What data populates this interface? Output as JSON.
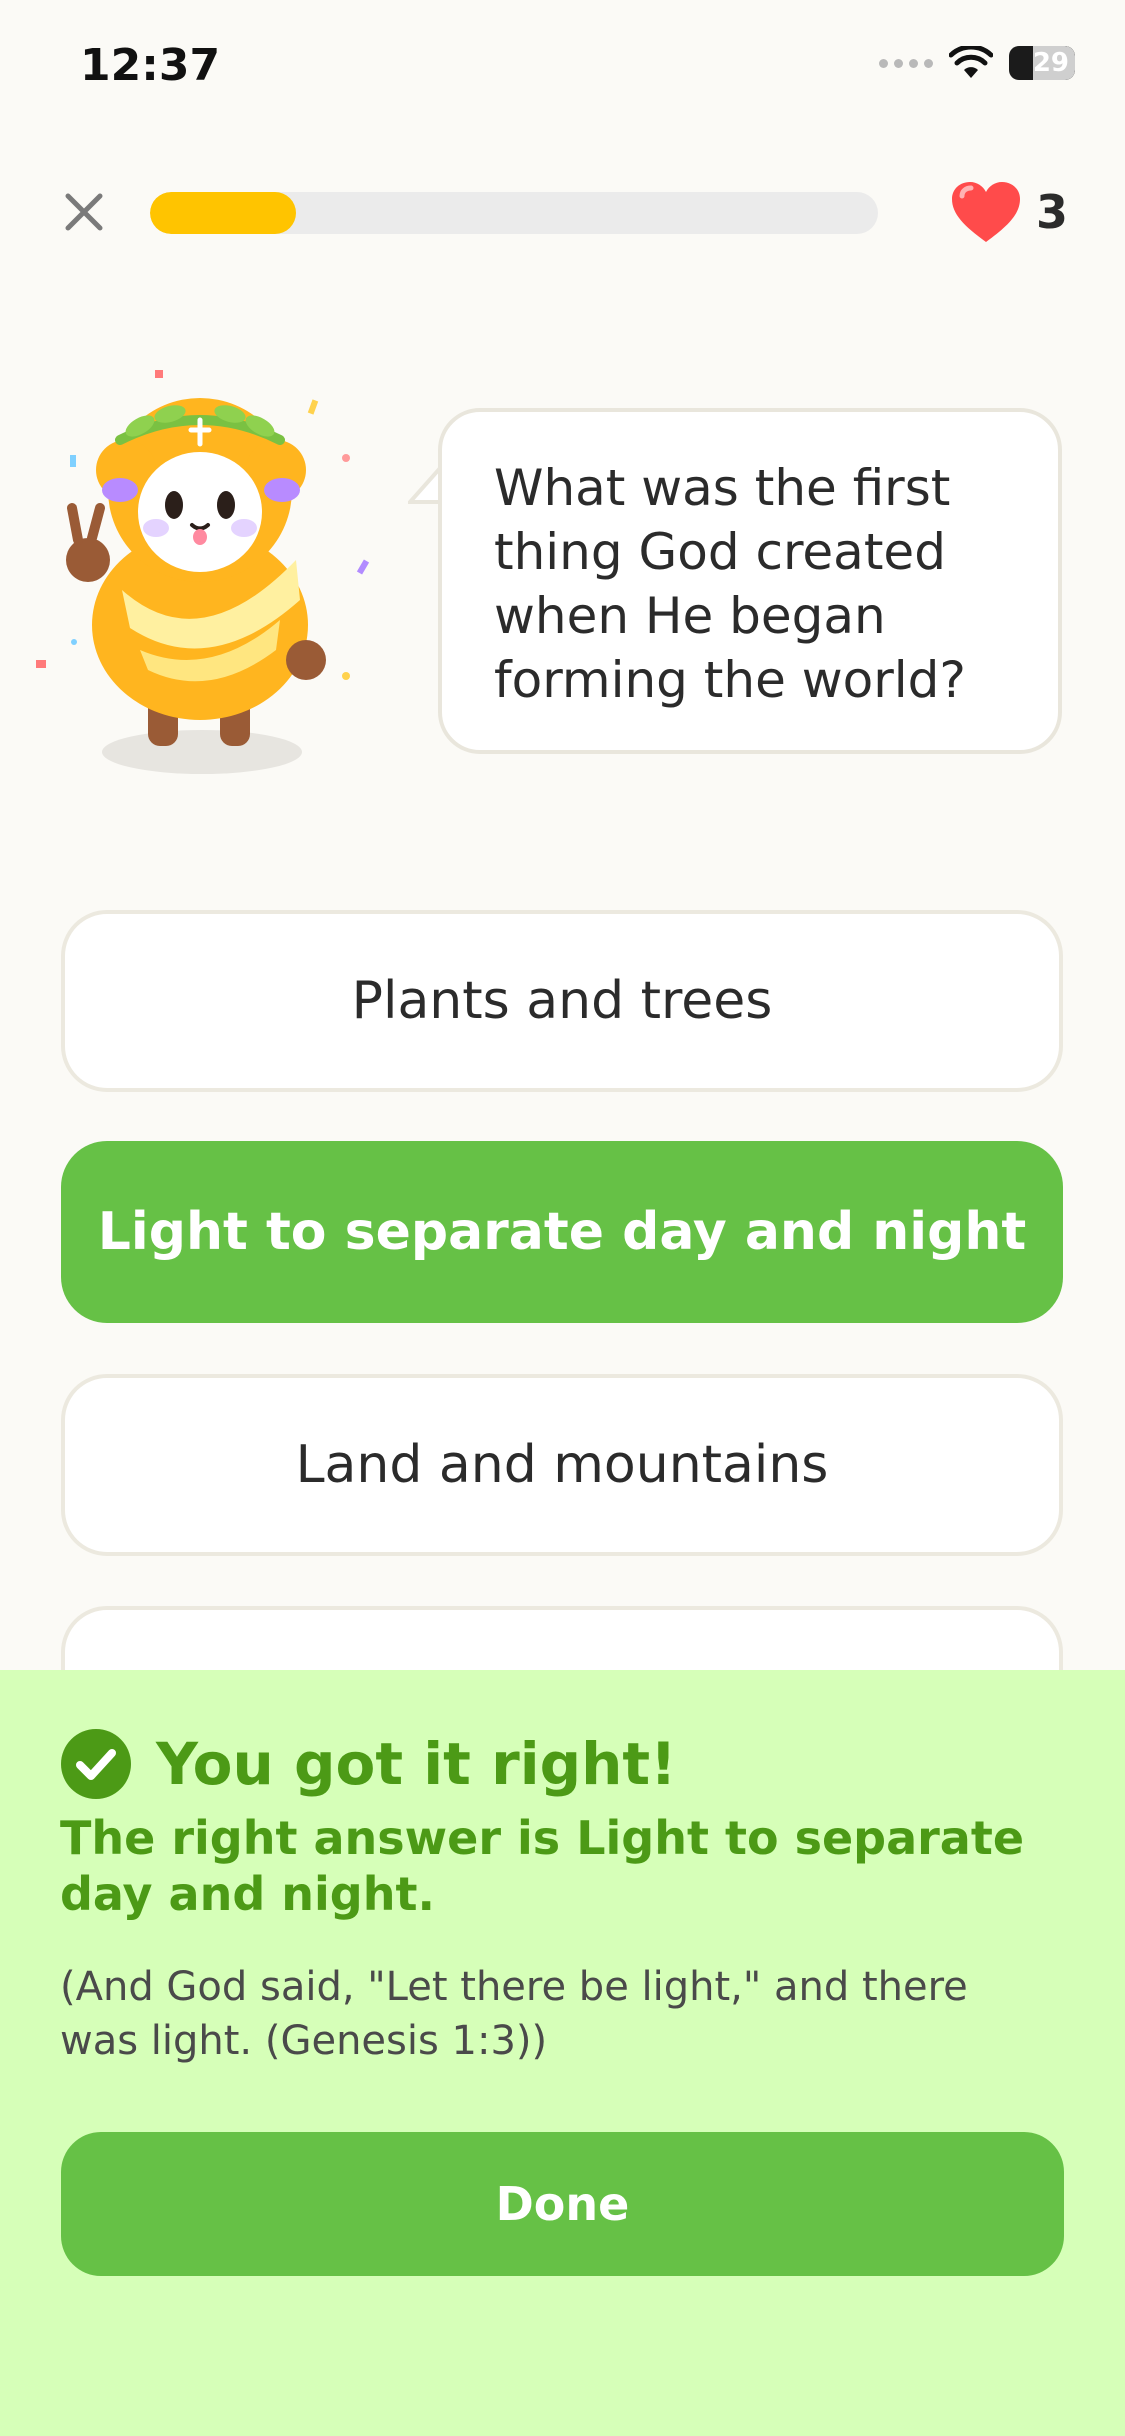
{
  "status_bar": {
    "time": "12:37",
    "battery": "29"
  },
  "top_bar": {
    "progress_fraction": 0.2,
    "hearts": "3"
  },
  "question": {
    "text": "What was the first thing God created when He began forming the world?"
  },
  "options": [
    {
      "label": "Plants and trees",
      "selected": false
    },
    {
      "label": "Light to separate day and night",
      "selected": true
    },
    {
      "label": "Land and mountains",
      "selected": false
    },
    {
      "label": "",
      "selected": false
    }
  ],
  "feedback": {
    "title": "You got it right!",
    "answer": "The right answer is Light to separate day and night.",
    "reference": "(And God said, \"Let there be light,\" and there was light. (Genesis 1:3))",
    "done_label": "Done"
  },
  "colors": {
    "accent_green": "#66c146",
    "progress_yellow": "#ffc400",
    "heart_red": "#ff4b4b",
    "feedback_bg": "#d6ffb8",
    "feedback_text": "#4c9a16"
  },
  "icons": [
    "close-icon",
    "heart-icon",
    "wifi-icon",
    "battery-icon",
    "check-circle-icon"
  ]
}
